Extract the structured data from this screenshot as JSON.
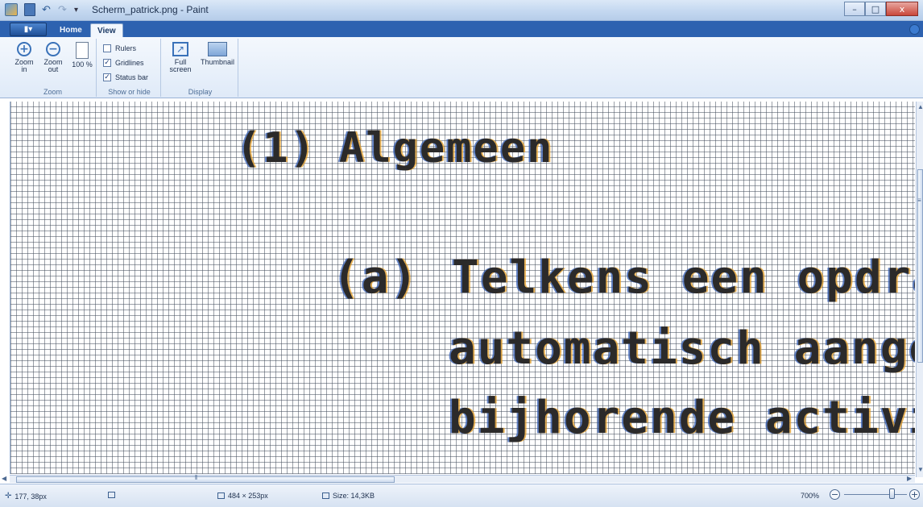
{
  "window": {
    "title": "Scherm_patrick.png - Paint",
    "quick_access": {
      "dropdown_glyph": "▾",
      "undo_glyph": "↶",
      "redo_glyph": "↷"
    },
    "controls": {
      "minimize": "–",
      "maximize": "□",
      "close": "x"
    }
  },
  "ribbon": {
    "app_menu_label": "▮▾",
    "tabs": [
      {
        "label": "Home",
        "selected": false
      },
      {
        "label": "View",
        "selected": true
      }
    ],
    "groups": {
      "zoom": {
        "label": "Zoom",
        "zoom_in": "Zoom in",
        "zoom_out": "Zoom out",
        "actual_size": "100 %"
      },
      "show_or_hide": {
        "label": "Show or hide",
        "rulers": {
          "label": "Rulers",
          "checked": false
        },
        "gridlines": {
          "label": "Gridlines",
          "checked": true
        },
        "status_bar": {
          "label": "Status bar",
          "checked": true
        }
      },
      "display": {
        "label": "Display",
        "full_screen": "Full screen",
        "thumbnail": "Thumbnail"
      }
    }
  },
  "canvas": {
    "lines": [
      {
        "marker": "(1)",
        "text": "Algemeen"
      },
      {
        "marker": "(a)",
        "text": "Telkens een opdracl"
      },
      {
        "marker": "",
        "text": "automatisch aangen"
      },
      {
        "marker": "",
        "text": "bijhorende activitei"
      }
    ]
  },
  "statusbar": {
    "cursor_position": "177, 38px",
    "image_dimensions": "484 × 253px",
    "file_size": "Size: 14,3KB",
    "zoom_level": "700%",
    "zoom_percent": 700
  },
  "colors": {
    "ribbon_tab_bar": "#2d62b0",
    "canvas_text": "#2b2a2a",
    "fringe_orange": "#e29b23",
    "fringe_blue": "#315cb4"
  }
}
